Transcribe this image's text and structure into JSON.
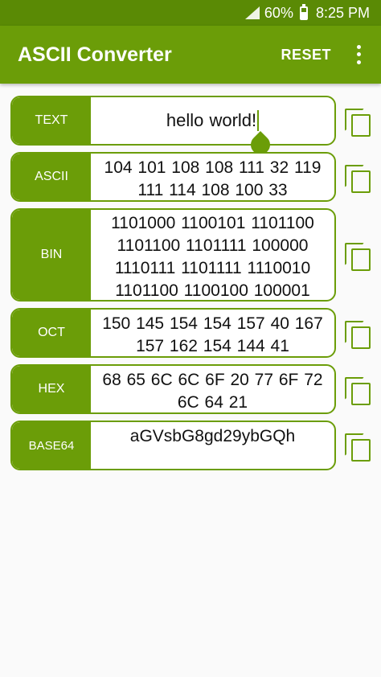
{
  "status_bar": {
    "battery": "60%",
    "time": "8:25 PM"
  },
  "app_bar": {
    "title": "ASCII Converter",
    "reset_label": "RESET"
  },
  "colors": {
    "primary": "#6b9d08",
    "primary_dark": "#5a8a05"
  },
  "rows": [
    {
      "label": "TEXT",
      "value": "hello world!"
    },
    {
      "label": "ASCII",
      "value": "104 101 108 108 111 32 119 111 114 108 100 33"
    },
    {
      "label": "BIN",
      "value": "1101000 1100101 1101100 1101100 1101111 100000 1110111 1101111 1110010 1101100 1100100 100001"
    },
    {
      "label": "OCT",
      "value": "150 145 154 154 157 40 167 157 162 154 144 41"
    },
    {
      "label": "HEX",
      "value": "68 65 6C 6C 6F 20 77 6F 72 6C 64 21"
    },
    {
      "label": "BASE64",
      "value": "aGVsbG8gd29ybGQh"
    }
  ]
}
